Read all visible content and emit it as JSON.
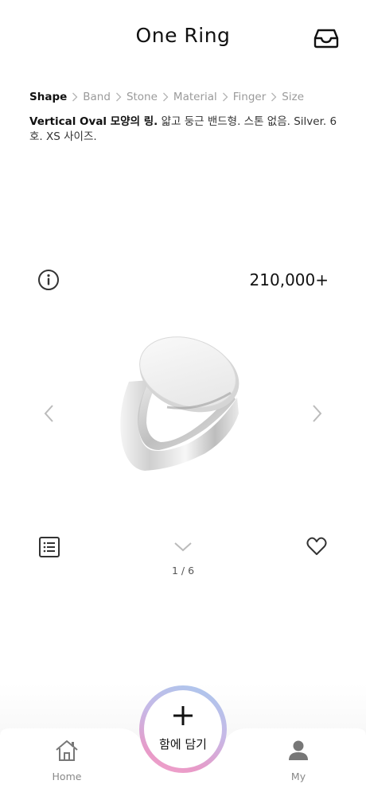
{
  "header": {
    "title": "One Ring",
    "inbox_icon": "inbox-tray-icon"
  },
  "breadcrumb": [
    {
      "label": "Shape",
      "active": true
    },
    {
      "label": "Band",
      "active": false
    },
    {
      "label": "Stone",
      "active": false
    },
    {
      "label": "Material",
      "active": false
    },
    {
      "label": "Finger",
      "active": false
    },
    {
      "label": "Size",
      "active": false
    }
  ],
  "description": {
    "bold": "Vertical Oval 모양의 링.",
    "rest": " 얇고 둥근 밴드형. 스톤 없음. Silver. 6호. XS 사이즈."
  },
  "product": {
    "price": "210,000+",
    "info_icon": "info-circle-icon",
    "image_icon": "signet-ring-image"
  },
  "gallery": {
    "pager": "1 / 6",
    "prev_icon": "chevron-left-icon",
    "next_icon": "chevron-right-icon",
    "list_icon": "list-icon",
    "expand_icon": "chevron-down-icon",
    "favorite_icon": "heart-icon"
  },
  "tabbar": {
    "home_label": "Home",
    "my_label": "My",
    "fab_label": "함에 담기",
    "fab_icon": "plus-icon"
  },
  "colors": {
    "text_primary": "#111111",
    "text_muted": "#9a9a9a",
    "fab_gradient_start": "#a9c9ee",
    "fab_gradient_end": "#f3a6cc"
  }
}
